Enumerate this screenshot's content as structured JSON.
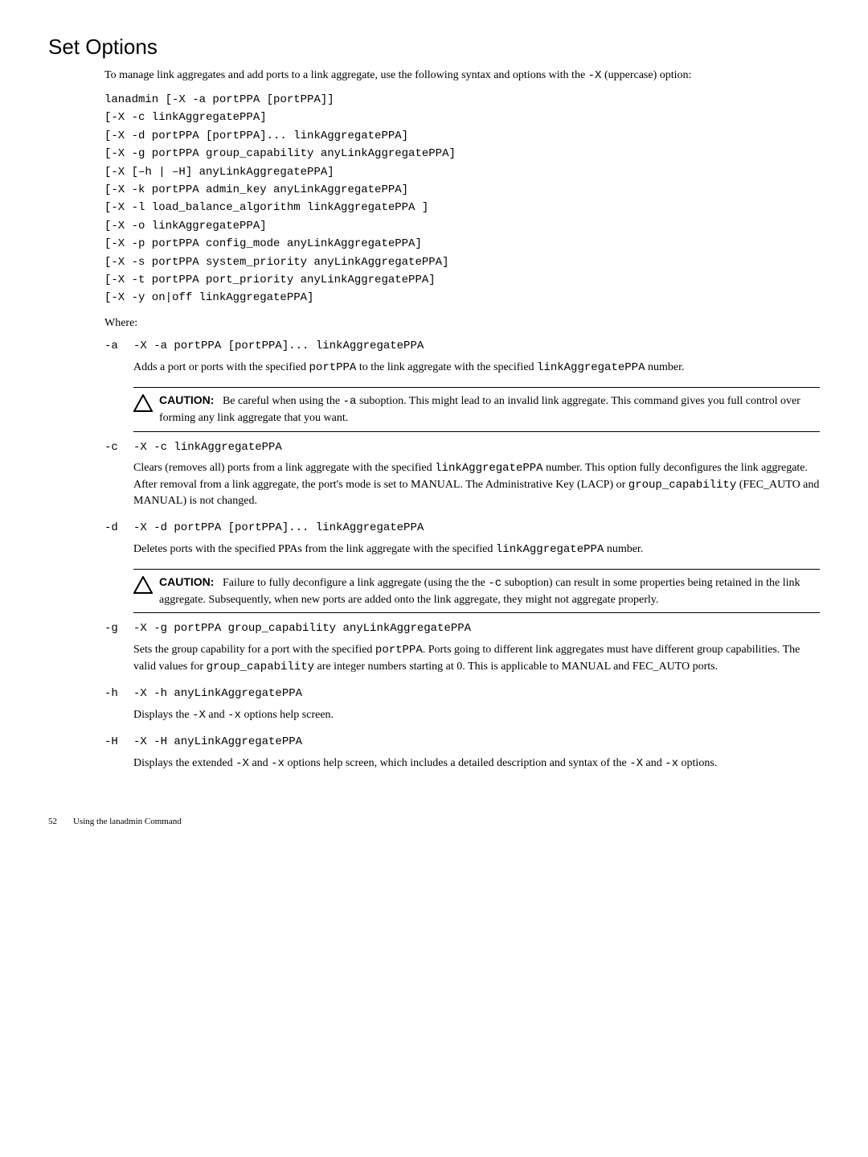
{
  "heading": "Set Options",
  "intro_prefix": "To manage link aggregates and add ports to a link aggregate, use the following syntax and options with the ",
  "intro_code": "-X",
  "intro_suffix": " (uppercase) option:",
  "syntax": [
    {
      "pre": "lanadmin ",
      "post": "[-X -a portPPA [portPPA]]"
    },
    {
      "pre": "",
      "post": "[-X -c linkAggregatePPA]"
    },
    {
      "pre": "",
      "post": "[-X -d portPPA [portPPA]... linkAggregatePPA]"
    },
    {
      "pre": "",
      "post": "[-X -g portPPA group_capability anyLinkAggregatePPA]"
    },
    {
      "pre": "",
      "post": "[-X [–h |  –H] anyLinkAggregatePPA]"
    },
    {
      "pre": "",
      "post": "[-X -k portPPA admin_key anyLinkAggregatePPA]"
    },
    {
      "pre": "",
      "post": "[-X -l load_balance_algorithm linkAggregatePPA ]"
    },
    {
      "pre": "",
      "post": "[-X -o linkAggregatePPA]"
    },
    {
      "pre": "",
      "post": "[-X -p portPPA config_mode anyLinkAggregatePPA]"
    },
    {
      "pre": "",
      "post": "[-X -s portPPA system_priority anyLinkAggregatePPA]"
    },
    {
      "pre": "",
      "post": "[-X -t portPPA port_priority anyLinkAggregatePPA]"
    },
    {
      "pre": "",
      "post": "[-X -y on|off linkAggregatePPA]"
    }
  ],
  "where": "Where:",
  "opt_a": {
    "key": "-a",
    "cmd": "-X -a portPPA [portPPA]... linkAggregatePPA",
    "desc_pre": "Adds a port or ports with the specified ",
    "desc_code1": "portPPA",
    "desc_mid": " to the link aggregate with the specified ",
    "desc_code2": "linkAggregatePPA",
    "desc_suf": " number."
  },
  "caution1": {
    "label": "CAUTION:",
    "pre": "Be careful when using the ",
    "code": "-a",
    "suf": " suboption. This might lead to an invalid link aggregate. This command gives you full control over forming any link aggregate that you want."
  },
  "opt_c": {
    "key": "-c",
    "cmd": "-X -c linkAggregatePPA",
    "d1": "Clears (removes all) ports from a link aggregate with the specified ",
    "c1": "linkAggregatePPA",
    "d2": " number. This option fully deconfigures the link aggregate. After removal from a link aggregate, the port's mode is set to MANUAL. The Administrative Key (LACP) or ",
    "c2": "group_capability",
    "d3": " (FEC_AUTO and MANUAL) is not changed."
  },
  "opt_d": {
    "key": "-d",
    "cmd": "-X -d portPPA [portPPA]... linkAggregatePPA",
    "d1": "Deletes ports with the specified PPAs from the link aggregate with the specified ",
    "c1": "linkAggregatePPA",
    "d2": " number."
  },
  "caution2": {
    "label": "CAUTION:",
    "pre": "Failure to fully deconfigure a link aggregate (using the the ",
    "code": "-c",
    "suf": " suboption) can result in some properties being retained in the link aggregate. Subsequently, when new ports are added onto the link aggregate, they might not aggregate properly."
  },
  "opt_g": {
    "key": "-g",
    "cmd": "-X -g portPPA group_capability anyLinkAggregatePPA",
    "d1": "Sets the group capability for a port with the specified ",
    "c1": "portPPA",
    "d2": ". Ports going to different link aggregates must have different group capabilities. The valid values for ",
    "c2": "group_capability",
    "d3": " are integer numbers starting at 0. This is applicable to MANUAL and FEC_AUTO ports."
  },
  "opt_h": {
    "key": "-h",
    "cmd": "-X -h anyLinkAggregatePPA",
    "d1": "Displays the ",
    "c1": "-X",
    "d2": " and ",
    "c2": "-x",
    "d3": " options help screen."
  },
  "opt_H": {
    "key": "-H",
    "cmd": "-X -H anyLinkAggregatePPA",
    "d1": "Displays the extended ",
    "c1": "-X",
    "d2": " and ",
    "c2": "-x",
    "d3": " options help screen, which includes a detailed description and syntax of the ",
    "c3": "-X",
    "d4": " and ",
    "c4": "-x",
    "d5": " options."
  },
  "footer": {
    "page": "52",
    "title": "Using the lanadmin Command"
  }
}
